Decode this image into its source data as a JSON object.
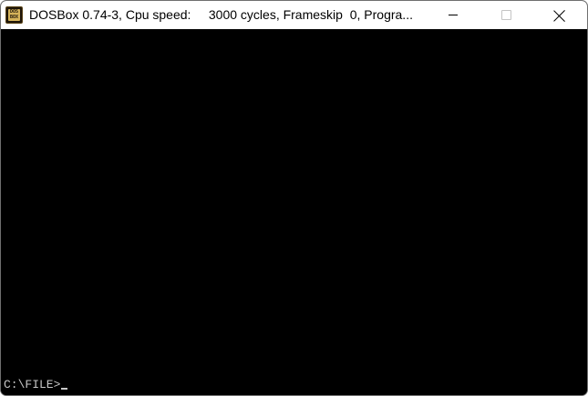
{
  "window": {
    "title": "DOSBox 0.74-3, Cpu speed:     3000 cycles, Frameskip  0, Progra...",
    "app_icon": "dosbox-icon",
    "icon_glyph_top": "DOS",
    "icon_glyph_bottom": "BOX",
    "controls": {
      "minimize_icon": "minimize-icon",
      "maximize_icon": "maximize-icon",
      "close_icon": "close-icon"
    }
  },
  "console": {
    "prompt": "C:\\FILE>",
    "cursor_icon": "text-cursor"
  },
  "colors": {
    "title_bar": "#ffffff",
    "screen": "#000000",
    "prompt_text": "#c8c8c8",
    "icon_gold": "#d6b45a"
  }
}
